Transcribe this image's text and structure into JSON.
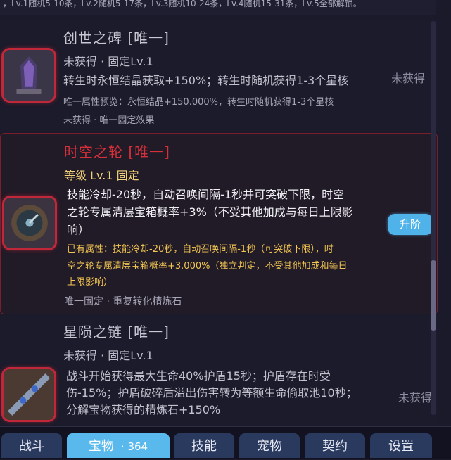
{
  "top_strip": {
    "text": "，Lv.1随机5-10条，Lv.2随机5-17条，Lv.3随机10-24条，Lv.4随机15-31条，Lv.5全部解锁。"
  },
  "cards": [
    {
      "title": "创世之碑 [唯一]",
      "meta": "未获得 · 固定Lv.1",
      "desc": "转生时永恒结晶获取+150%；转生时随机获得1-3个星核",
      "preview": "唯一属性预览：永恒结晶+150.000%，转生时随机获得1-3个星核",
      "footer": "未获得 · 唯一固定效果",
      "status": "未获得",
      "icon": "monolith-icon"
    },
    {
      "title": "时空之轮 [唯一]",
      "meta": "等级 Lv.1 固定",
      "desc_lines": [
        "技能冷却-20秒，自动召唤间隔-1秒并可突破下限，时空",
        "之轮专属清层宝箱概率+3%（不受其他加成与每日上限影",
        "响）"
      ],
      "owned_lines": [
        "已有属性：技能冷却-20秒，自动召唤间隔-1秒（可突破下限），时",
        "空之轮专属清层宝箱概率+3.000%（独立判定，不受其他加成和每日",
        "上限影响）"
      ],
      "footer": "唯一固定 · 重复转化精炼石",
      "button": "升阶",
      "icon": "time-wheel-icon"
    },
    {
      "title": "星陨之链 [唯一]",
      "meta": "未获得 · 固定Lv.1",
      "desc_lines": [
        "战斗开始获得最大生命40%护盾15秒；护盾存在时受",
        "伤-15%；护盾破碎后溢出伤害转为等额生命偷取池10秒；",
        "分解宝物获得的精炼石+150%"
      ],
      "status": "未获得",
      "icon": "chain-icon"
    }
  ],
  "tabs": [
    {
      "label": "战斗"
    },
    {
      "label": "宝物",
      "badge": "· 364"
    },
    {
      "label": "技能"
    },
    {
      "label": "宠物"
    },
    {
      "label": "契约"
    },
    {
      "label": "设置"
    }
  ],
  "colors": {
    "accent": "#5ab9ec",
    "rare_red": "#d8303a",
    "gold": "#f2d27a"
  }
}
